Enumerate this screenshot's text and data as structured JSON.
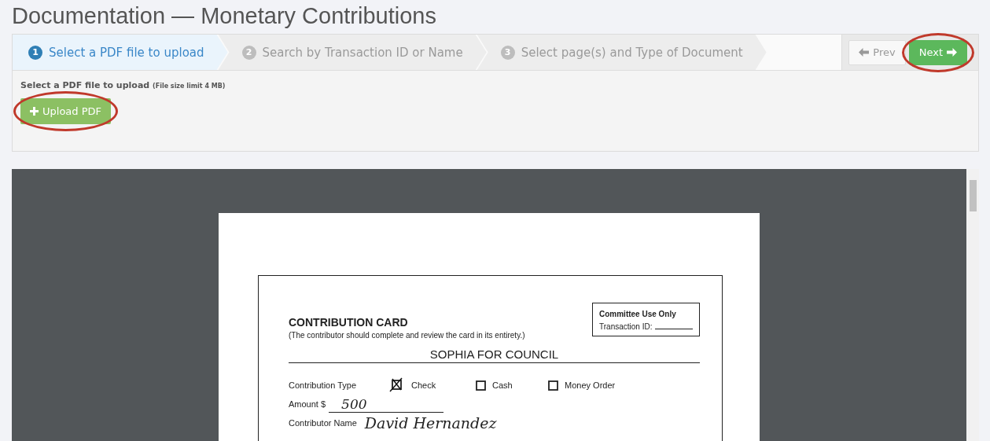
{
  "title": "Documentation — Monetary Contributions",
  "steps": [
    {
      "number": "1",
      "label": "Select a PDF file to upload",
      "selected": true
    },
    {
      "number": "2",
      "label": "Search by Transaction ID or Name",
      "selected": false
    },
    {
      "number": "3",
      "label": "Select page(s) and Type of Document",
      "selected": false
    }
  ],
  "nav_buttons": [
    {
      "label": "Prev",
      "kind": "prev",
      "highlighted": false
    },
    {
      "label": "Next",
      "kind": "next",
      "highlighted": true
    }
  ],
  "upload": {
    "label": "Select a PDF file to upload",
    "note": "(File size limit 4 MB)",
    "button": "Upload PDF",
    "highlighted": true
  },
  "document": {
    "heading": "CONTRIBUTION CARD",
    "subheading": "(The contributor should complete and review the card in its entirety.)",
    "committee_title": "Committee Use Only",
    "committee_field": "Transaction ID:",
    "campaign": "SOPHIA FOR COUNCIL",
    "type_label": "Contribution Type",
    "types": [
      {
        "label": "Check",
        "checked": true
      },
      {
        "label": "Cash",
        "checked": false
      },
      {
        "label": "Money Order",
        "checked": false
      }
    ],
    "amount_label": "Amount $",
    "amount": "500",
    "name_label": "Contributor Name",
    "name": "David Hernandez"
  }
}
